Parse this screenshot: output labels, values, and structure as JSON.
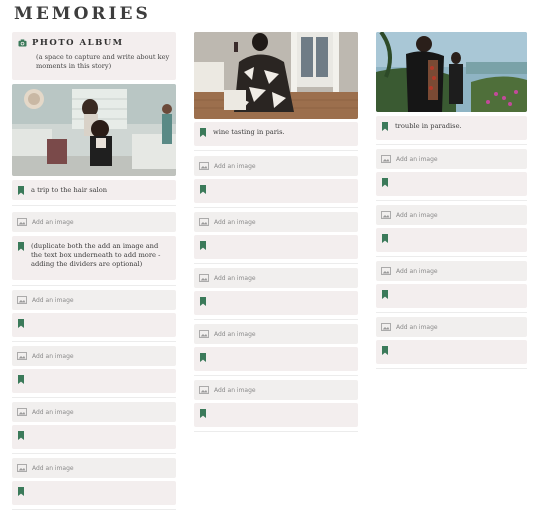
{
  "page": {
    "title": "MEMORIES"
  },
  "album": {
    "title": "PHOTO ALBUM",
    "description": "(a space to capture and write about key moments in this story)"
  },
  "add_image_label": "Add an image",
  "columns": {
    "col1": {
      "captions": [
        "a trip to the hair salon",
        "(duplicate both the add an image and the text box underneath to add more - adding the dividers are optional)",
        "",
        "",
        "",
        ""
      ]
    },
    "col2": {
      "captions": [
        "wine tasting in paris.",
        "",
        "",
        "",
        "",
        ""
      ]
    },
    "col3": {
      "captions": [
        "trouble in paradise.",
        "",
        "",
        "",
        ""
      ]
    }
  },
  "colors": {
    "card_bg": "#f3eeee",
    "add_image_bg": "#f1efee",
    "accent_green": "#3b7a5a",
    "title": "#3d3d3d"
  },
  "icons": {
    "album": "camera-icon",
    "caption": "bookmark-icon",
    "add_image": "image-icon"
  }
}
